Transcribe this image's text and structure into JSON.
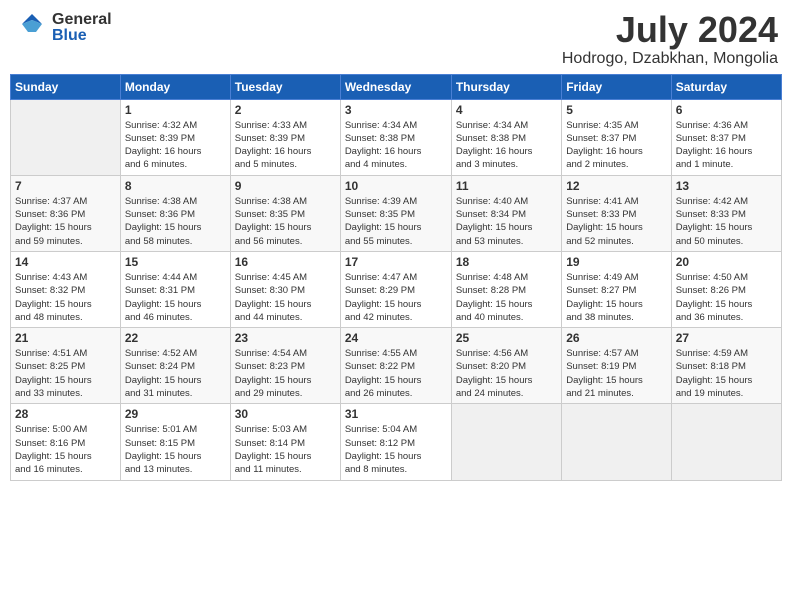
{
  "logo": {
    "general": "General",
    "blue": "Blue"
  },
  "title": "July 2024",
  "location": "Hodrogo, Dzabkhan, Mongolia",
  "days_of_week": [
    "Sunday",
    "Monday",
    "Tuesday",
    "Wednesday",
    "Thursday",
    "Friday",
    "Saturday"
  ],
  "weeks": [
    [
      {
        "day": "",
        "info": ""
      },
      {
        "day": "1",
        "info": "Sunrise: 4:32 AM\nSunset: 8:39 PM\nDaylight: 16 hours\nand 6 minutes."
      },
      {
        "day": "2",
        "info": "Sunrise: 4:33 AM\nSunset: 8:39 PM\nDaylight: 16 hours\nand 5 minutes."
      },
      {
        "day": "3",
        "info": "Sunrise: 4:34 AM\nSunset: 8:38 PM\nDaylight: 16 hours\nand 4 minutes."
      },
      {
        "day": "4",
        "info": "Sunrise: 4:34 AM\nSunset: 8:38 PM\nDaylight: 16 hours\nand 3 minutes."
      },
      {
        "day": "5",
        "info": "Sunrise: 4:35 AM\nSunset: 8:37 PM\nDaylight: 16 hours\nand 2 minutes."
      },
      {
        "day": "6",
        "info": "Sunrise: 4:36 AM\nSunset: 8:37 PM\nDaylight: 16 hours\nand 1 minute."
      }
    ],
    [
      {
        "day": "7",
        "info": "Sunrise: 4:37 AM\nSunset: 8:36 PM\nDaylight: 15 hours\nand 59 minutes."
      },
      {
        "day": "8",
        "info": "Sunrise: 4:38 AM\nSunset: 8:36 PM\nDaylight: 15 hours\nand 58 minutes."
      },
      {
        "day": "9",
        "info": "Sunrise: 4:38 AM\nSunset: 8:35 PM\nDaylight: 15 hours\nand 56 minutes."
      },
      {
        "day": "10",
        "info": "Sunrise: 4:39 AM\nSunset: 8:35 PM\nDaylight: 15 hours\nand 55 minutes."
      },
      {
        "day": "11",
        "info": "Sunrise: 4:40 AM\nSunset: 8:34 PM\nDaylight: 15 hours\nand 53 minutes."
      },
      {
        "day": "12",
        "info": "Sunrise: 4:41 AM\nSunset: 8:33 PM\nDaylight: 15 hours\nand 52 minutes."
      },
      {
        "day": "13",
        "info": "Sunrise: 4:42 AM\nSunset: 8:33 PM\nDaylight: 15 hours\nand 50 minutes."
      }
    ],
    [
      {
        "day": "14",
        "info": "Sunrise: 4:43 AM\nSunset: 8:32 PM\nDaylight: 15 hours\nand 48 minutes."
      },
      {
        "day": "15",
        "info": "Sunrise: 4:44 AM\nSunset: 8:31 PM\nDaylight: 15 hours\nand 46 minutes."
      },
      {
        "day": "16",
        "info": "Sunrise: 4:45 AM\nSunset: 8:30 PM\nDaylight: 15 hours\nand 44 minutes."
      },
      {
        "day": "17",
        "info": "Sunrise: 4:47 AM\nSunset: 8:29 PM\nDaylight: 15 hours\nand 42 minutes."
      },
      {
        "day": "18",
        "info": "Sunrise: 4:48 AM\nSunset: 8:28 PM\nDaylight: 15 hours\nand 40 minutes."
      },
      {
        "day": "19",
        "info": "Sunrise: 4:49 AM\nSunset: 8:27 PM\nDaylight: 15 hours\nand 38 minutes."
      },
      {
        "day": "20",
        "info": "Sunrise: 4:50 AM\nSunset: 8:26 PM\nDaylight: 15 hours\nand 36 minutes."
      }
    ],
    [
      {
        "day": "21",
        "info": "Sunrise: 4:51 AM\nSunset: 8:25 PM\nDaylight: 15 hours\nand 33 minutes."
      },
      {
        "day": "22",
        "info": "Sunrise: 4:52 AM\nSunset: 8:24 PM\nDaylight: 15 hours\nand 31 minutes."
      },
      {
        "day": "23",
        "info": "Sunrise: 4:54 AM\nSunset: 8:23 PM\nDaylight: 15 hours\nand 29 minutes."
      },
      {
        "day": "24",
        "info": "Sunrise: 4:55 AM\nSunset: 8:22 PM\nDaylight: 15 hours\nand 26 minutes."
      },
      {
        "day": "25",
        "info": "Sunrise: 4:56 AM\nSunset: 8:20 PM\nDaylight: 15 hours\nand 24 minutes."
      },
      {
        "day": "26",
        "info": "Sunrise: 4:57 AM\nSunset: 8:19 PM\nDaylight: 15 hours\nand 21 minutes."
      },
      {
        "day": "27",
        "info": "Sunrise: 4:59 AM\nSunset: 8:18 PM\nDaylight: 15 hours\nand 19 minutes."
      }
    ],
    [
      {
        "day": "28",
        "info": "Sunrise: 5:00 AM\nSunset: 8:16 PM\nDaylight: 15 hours\nand 16 minutes."
      },
      {
        "day": "29",
        "info": "Sunrise: 5:01 AM\nSunset: 8:15 PM\nDaylight: 15 hours\nand 13 minutes."
      },
      {
        "day": "30",
        "info": "Sunrise: 5:03 AM\nSunset: 8:14 PM\nDaylight: 15 hours\nand 11 minutes."
      },
      {
        "day": "31",
        "info": "Sunrise: 5:04 AM\nSunset: 8:12 PM\nDaylight: 15 hours\nand 8 minutes."
      },
      {
        "day": "",
        "info": ""
      },
      {
        "day": "",
        "info": ""
      },
      {
        "day": "",
        "info": ""
      }
    ]
  ]
}
